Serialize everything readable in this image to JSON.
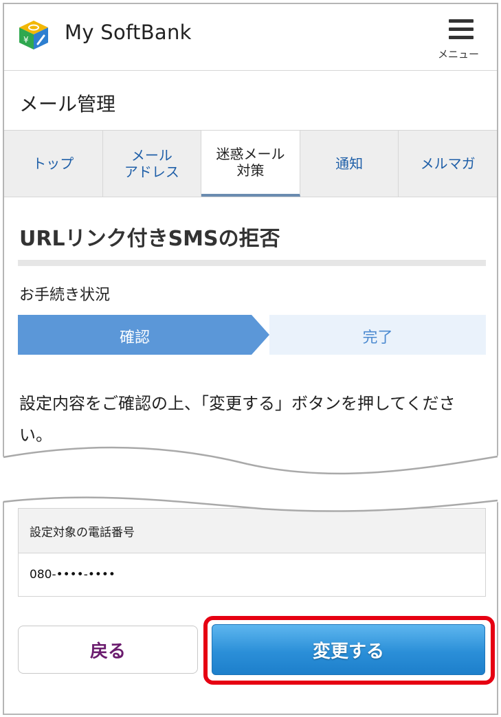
{
  "header": {
    "brand": "My SoftBank",
    "menu_label": "メニュー"
  },
  "page_title": "メール管理",
  "tabs": [
    {
      "label": "トップ"
    },
    {
      "label": "メール\nアドレス"
    },
    {
      "label": "迷惑メール\n対策"
    },
    {
      "label": "通知"
    },
    {
      "label": "メルマガ"
    }
  ],
  "section_title": "URLリンク付きSMSの拒否",
  "status": {
    "label": "お手続き状況",
    "steps": [
      "確認",
      "完了"
    ]
  },
  "instruction": "設定内容をご確認の上、「変更する」ボタンを押してください。",
  "table": {
    "header": "設定対象の電話番号",
    "value": "080-••••-••••"
  },
  "buttons": {
    "back": "戻る",
    "change": "変更する"
  },
  "colors": {
    "tab_link": "#1f5fa8",
    "step_active": "#5b97d8",
    "highlight": "#e60012",
    "back_text": "#6b1c6e"
  }
}
